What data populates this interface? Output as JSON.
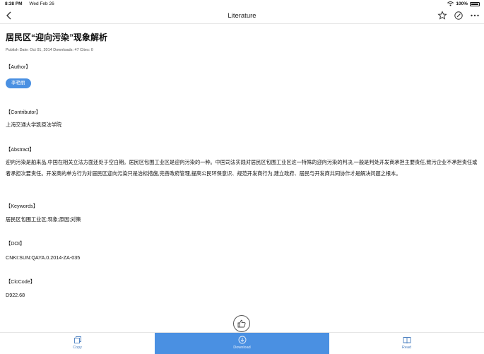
{
  "status": {
    "time": "8:38 PM",
    "date": "Wed Feb 26",
    "battery": "100%"
  },
  "nav": {
    "title": "Literature"
  },
  "article": {
    "title": "居民区“迎向污染”现象解析",
    "meta": "Publish Date: Oct 01, 2014  Downloads: 47  Cites: 0",
    "author_head": "【Author】",
    "author": "李艳丽",
    "contributor_head": "【Contributor】",
    "contributor": "上海交通大学凯原法学院",
    "abstract_head": "【Abstract】",
    "abstract": "迎向污染是舶来品,中国在相关立法方面还处于空白期。居民区包围工业区是迎向污染的一种。中国司法实践对居民区包围工业区这一特殊的迎向污染的判决,一般是判处开发商承担主要责任,致污企业不承担责任或者承担次要责任。开发商的单方行为对居民区迎向污染只是治标措施,完善政府管理,提高公民环保意识、规范开发商行为,建立政府、居民与开发商共同协作才是解决问题之根本。",
    "keywords_head": "【Keywords】",
    "keywords": "居民区包围工业区;现象;原因;对策",
    "doi_head": "【DOI】",
    "doi": "CNKI:SUN:QAYA.0.2014-ZA-035",
    "clc_head": "【ClcCode】",
    "clc": "D922.68"
  },
  "bottom": {
    "copy": "Copy",
    "download": "Download",
    "read": "Read"
  },
  "colors": {
    "accent": "#4a90e2"
  }
}
